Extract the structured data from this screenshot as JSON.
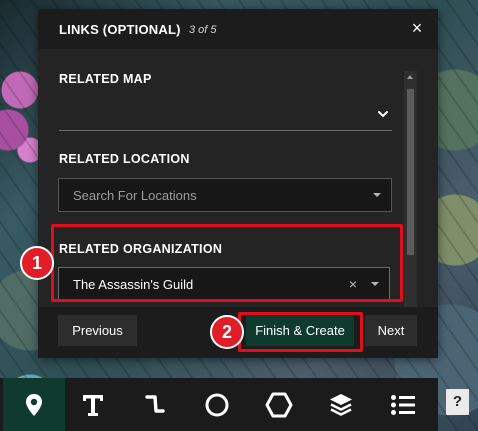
{
  "modal": {
    "title": "LINKS (OPTIONAL)",
    "step": "3 of 5",
    "close_label": "×"
  },
  "sections": {
    "related_map": {
      "label": "RELATED MAP",
      "value": ""
    },
    "related_location": {
      "label": "RELATED LOCATION",
      "placeholder": "Search For Locations"
    },
    "related_organization": {
      "label": "RELATED ORGANIZATION",
      "value": "The Assassin's Guild",
      "clear_label": "×"
    }
  },
  "footer": {
    "previous_label": "Previous",
    "finish_label": "Finish & Create",
    "next_label": "Next"
  },
  "annotations": {
    "badge_1": "1",
    "badge_2": "2",
    "highlight_color": "#e10e1d"
  },
  "toolbar": {
    "tools": [
      "marker-icon",
      "text-icon",
      "line-icon",
      "circle-icon",
      "polygon-icon",
      "layers-icon",
      "list-icon"
    ],
    "active_tool": "marker-icon",
    "help_label": "?"
  },
  "colors": {
    "accent": "#0f3b2f",
    "modal_bg": "#1c1c1c",
    "body_bg": "#242424"
  }
}
